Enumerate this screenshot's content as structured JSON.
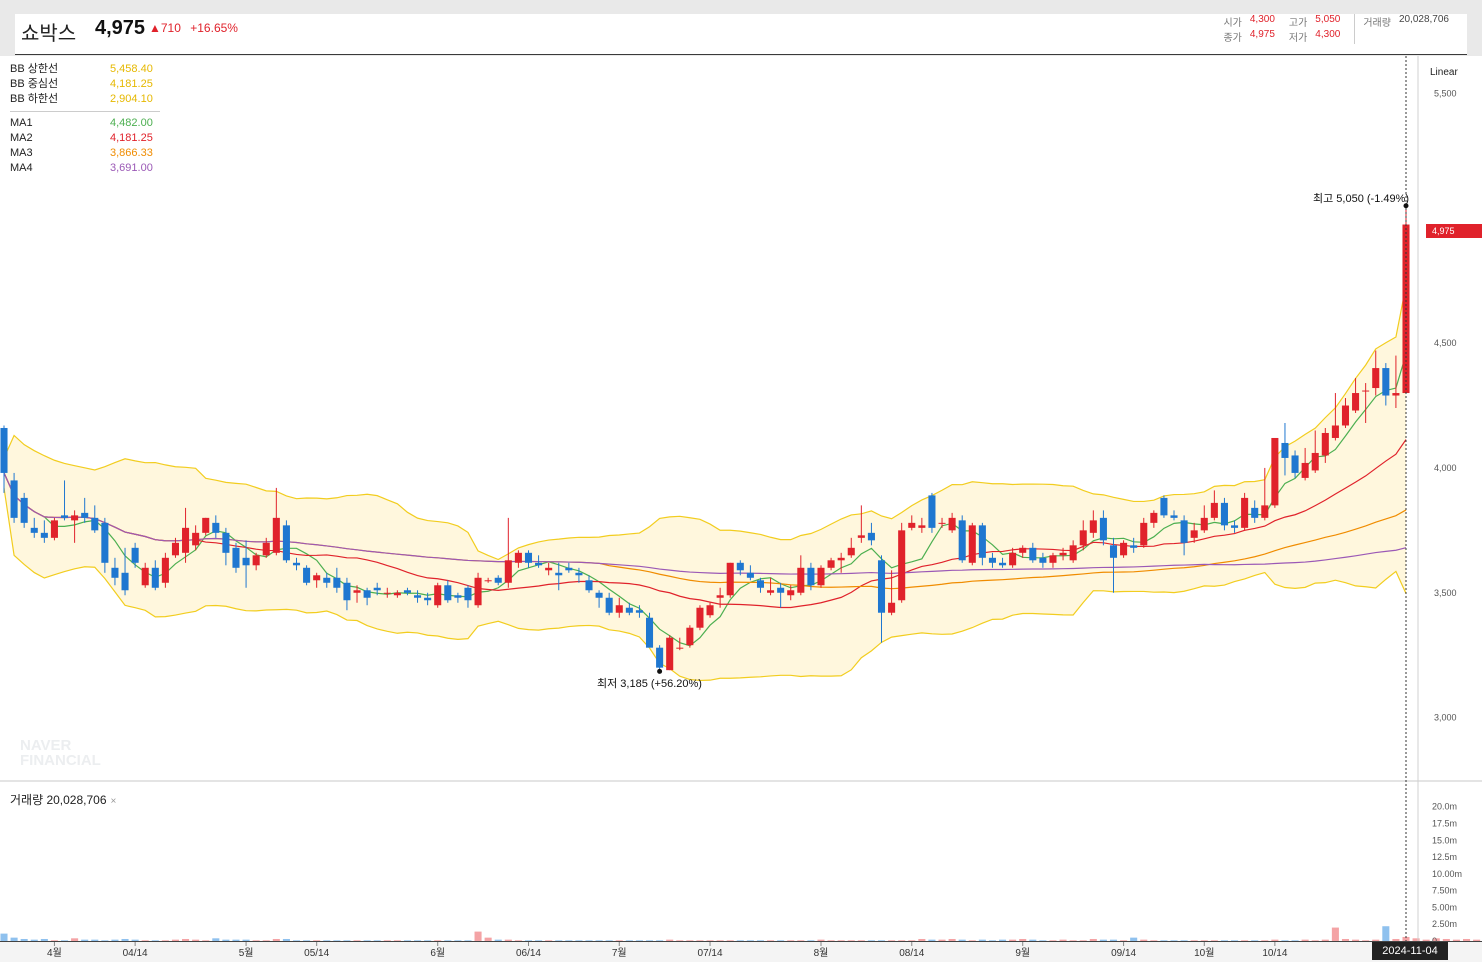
{
  "header": {
    "name": "쇼박스",
    "price": "4,975",
    "change": "▲710",
    "change_pct": "+16.65%",
    "ohlc": {
      "open_label": "시가",
      "open": "4,300",
      "high_label": "고가",
      "high": "5,050",
      "volume_label": "거래량",
      "volume": "20,028,706",
      "close_label": "종가",
      "close": "4,975",
      "low_label": "저가",
      "low": "4,300"
    }
  },
  "legend": {
    "bb": [
      {
        "name": "BB 상한선",
        "value": "5,458.40",
        "color": "#e6b800"
      },
      {
        "name": "BB 중심선",
        "value": "4,181.25",
        "color": "#e6b800"
      },
      {
        "name": "BB 하한선",
        "value": "2,904.10",
        "color": "#e6b800"
      }
    ],
    "ma": [
      {
        "name": "MA1",
        "value": "4,482.00",
        "color": "#4caf50"
      },
      {
        "name": "MA2",
        "value": "4,181.25",
        "color": "#e0222b"
      },
      {
        "name": "MA3",
        "value": "3,866.33",
        "color": "#f08c00"
      },
      {
        "name": "MA4",
        "value": "3,691.00",
        "color": "#9b59b6"
      }
    ]
  },
  "watermark": [
    "NAVER",
    "FINANCIAL"
  ],
  "scale_mode": "Linear",
  "volume_label": "거래량 20,028,706",
  "volume_close": "×",
  "current_price_badge": "4,975",
  "date_badge": "2024-11-04",
  "annotations": {
    "high": "최고 5,050 (-1.49%)",
    "low": "최저 3,185 (+56.20%)"
  },
  "colors": {
    "up": "#e0222b",
    "down": "#1f77d0",
    "band_fill": "#fff7dd",
    "band_line": "#f2cd1f"
  },
  "chart_data": {
    "type": "candlestick",
    "x_ticks": [
      "4월",
      "04/14",
      "5월",
      "05/14",
      "6월",
      "06/14",
      "7월",
      "07/14",
      "8월",
      "08/14",
      "9월",
      "09/14",
      "10월",
      "10/14"
    ],
    "y_ticks": [
      "5,500",
      "4,500",
      "4,000",
      "3,500",
      "3,000"
    ],
    "y_tick_values": [
      5500,
      4500,
      4000,
      3500,
      3000
    ],
    "ylim": [
      2750,
      5650
    ],
    "volume_ticks": [
      "20.0m",
      "17.5m",
      "15.0m",
      "12.5m",
      "10.00m",
      "7.50m",
      "5.00m",
      "2.50m",
      "0"
    ],
    "volume_tick_values": [
      20,
      17.5,
      15,
      12.5,
      10,
      7.5,
      5,
      2.5,
      0
    ],
    "volume_ylim": [
      0,
      21
    ],
    "candles": [
      [
        4160,
        4170,
        3900,
        3980
      ],
      [
        3950,
        3980,
        3780,
        3800
      ],
      [
        3880,
        3900,
        3760,
        3780
      ],
      [
        3760,
        3800,
        3720,
        3740
      ],
      [
        3740,
        3790,
        3700,
        3720
      ],
      [
        3720,
        3800,
        3710,
        3790
      ],
      [
        3810,
        3950,
        3790,
        3800
      ],
      [
        3790,
        3830,
        3700,
        3810
      ],
      [
        3820,
        3880,
        3780,
        3800
      ],
      [
        3800,
        3850,
        3740,
        3750
      ],
      [
        3780,
        3800,
        3580,
        3620
      ],
      [
        3600,
        3640,
        3530,
        3560
      ],
      [
        3580,
        3680,
        3490,
        3510
      ],
      [
        3680,
        3700,
        3600,
        3620
      ],
      [
        3530,
        3620,
        3520,
        3600
      ],
      [
        3600,
        3630,
        3510,
        3520
      ],
      [
        3540,
        3660,
        3520,
        3640
      ],
      [
        3650,
        3720,
        3640,
        3700
      ],
      [
        3660,
        3840,
        3620,
        3760
      ],
      [
        3690,
        3770,
        3670,
        3740
      ],
      [
        3740,
        3800,
        3730,
        3800
      ],
      [
        3780,
        3810,
        3720,
        3740
      ],
      [
        3740,
        3760,
        3610,
        3660
      ],
      [
        3680,
        3700,
        3580,
        3600
      ],
      [
        3640,
        3710,
        3520,
        3610
      ],
      [
        3610,
        3660,
        3590,
        3650
      ],
      [
        3650,
        3720,
        3640,
        3700
      ],
      [
        3660,
        3920,
        3650,
        3800
      ],
      [
        3770,
        3790,
        3620,
        3630
      ],
      [
        3620,
        3640,
        3590,
        3610
      ],
      [
        3600,
        3610,
        3530,
        3540
      ],
      [
        3550,
        3580,
        3520,
        3570
      ],
      [
        3560,
        3580,
        3520,
        3540
      ],
      [
        3560,
        3600,
        3500,
        3520
      ],
      [
        3540,
        3560,
        3430,
        3470
      ],
      [
        3500,
        3530,
        3460,
        3510
      ],
      [
        3510,
        3520,
        3450,
        3480
      ],
      [
        3520,
        3540,
        3490,
        3510
      ],
      [
        3500,
        3520,
        3480,
        3500
      ],
      [
        3490,
        3510,
        3480,
        3500
      ],
      [
        3510,
        3520,
        3490,
        3500
      ],
      [
        3490,
        3510,
        3460,
        3480
      ],
      [
        3480,
        3500,
        3450,
        3470
      ],
      [
        3450,
        3540,
        3440,
        3530
      ],
      [
        3530,
        3550,
        3460,
        3470
      ],
      [
        3490,
        3500,
        3460,
        3480
      ],
      [
        3520,
        3530,
        3440,
        3470
      ],
      [
        3450,
        3580,
        3440,
        3560
      ],
      [
        3550,
        3560,
        3540,
        3550
      ],
      [
        3560,
        3570,
        3530,
        3540
      ],
      [
        3540,
        3800,
        3520,
        3630
      ],
      [
        3620,
        3670,
        3600,
        3660
      ],
      [
        3660,
        3670,
        3600,
        3620
      ],
      [
        3620,
        3650,
        3600,
        3610
      ],
      [
        3590,
        3620,
        3570,
        3600
      ],
      [
        3580,
        3620,
        3510,
        3570
      ],
      [
        3600,
        3620,
        3580,
        3590
      ],
      [
        3580,
        3600,
        3540,
        3570
      ],
      [
        3550,
        3570,
        3500,
        3510
      ],
      [
        3500,
        3510,
        3440,
        3480
      ],
      [
        3480,
        3500,
        3410,
        3420
      ],
      [
        3420,
        3480,
        3400,
        3450
      ],
      [
        3440,
        3460,
        3410,
        3420
      ],
      [
        3430,
        3450,
        3400,
        3420
      ],
      [
        3400,
        3420,
        3300,
        3280
      ],
      [
        3280,
        3290,
        3185,
        3200
      ],
      [
        3190,
        3330,
        3190,
        3320
      ],
      [
        3280,
        3320,
        3270,
        3280
      ],
      [
        3290,
        3370,
        3280,
        3360
      ],
      [
        3360,
        3450,
        3350,
        3440
      ],
      [
        3410,
        3460,
        3400,
        3450
      ],
      [
        3480,
        3520,
        3440,
        3490
      ],
      [
        3490,
        3620,
        3480,
        3620
      ],
      [
        3620,
        3630,
        3570,
        3590
      ],
      [
        3580,
        3610,
        3550,
        3560
      ],
      [
        3550,
        3560,
        3500,
        3520
      ],
      [
        3500,
        3560,
        3490,
        3510
      ],
      [
        3520,
        3540,
        3440,
        3500
      ],
      [
        3490,
        3530,
        3470,
        3510
      ],
      [
        3500,
        3650,
        3490,
        3600
      ],
      [
        3600,
        3620,
        3510,
        3530
      ],
      [
        3530,
        3610,
        3520,
        3600
      ],
      [
        3600,
        3640,
        3590,
        3630
      ],
      [
        3630,
        3660,
        3580,
        3640
      ],
      [
        3650,
        3720,
        3640,
        3680
      ],
      [
        3720,
        3850,
        3700,
        3730
      ],
      [
        3740,
        3780,
        3690,
        3710
      ],
      [
        3630,
        3650,
        3300,
        3420
      ],
      [
        3420,
        3590,
        3410,
        3460
      ],
      [
        3470,
        3780,
        3460,
        3750
      ],
      [
        3760,
        3810,
        3750,
        3780
      ],
      [
        3760,
        3800,
        3740,
        3770
      ],
      [
        3890,
        3900,
        3740,
        3760
      ],
      [
        3780,
        3800,
        3760,
        3780
      ],
      [
        3750,
        3820,
        3740,
        3800
      ],
      [
        3790,
        3810,
        3620,
        3630
      ],
      [
        3620,
        3780,
        3610,
        3770
      ],
      [
        3770,
        3780,
        3610,
        3640
      ],
      [
        3640,
        3660,
        3600,
        3620
      ],
      [
        3620,
        3640,
        3600,
        3610
      ],
      [
        3610,
        3680,
        3600,
        3660
      ],
      [
        3660,
        3690,
        3640,
        3680
      ],
      [
        3680,
        3700,
        3620,
        3630
      ],
      [
        3640,
        3660,
        3600,
        3620
      ],
      [
        3620,
        3660,
        3600,
        3650
      ],
      [
        3650,
        3680,
        3630,
        3660
      ],
      [
        3630,
        3710,
        3620,
        3690
      ],
      [
        3690,
        3790,
        3670,
        3750
      ],
      [
        3740,
        3830,
        3720,
        3790
      ],
      [
        3800,
        3830,
        3690,
        3710
      ],
      [
        3690,
        3720,
        3500,
        3640
      ],
      [
        3650,
        3710,
        3640,
        3700
      ],
      [
        3690,
        3720,
        3660,
        3680
      ],
      [
        3690,
        3800,
        3680,
        3780
      ],
      [
        3780,
        3830,
        3760,
        3820
      ],
      [
        3880,
        3890,
        3800,
        3810
      ],
      [
        3810,
        3830,
        3790,
        3800
      ],
      [
        3790,
        3810,
        3650,
        3700
      ],
      [
        3720,
        3780,
        3700,
        3750
      ],
      [
        3750,
        3850,
        3740,
        3800
      ],
      [
        3800,
        3910,
        3790,
        3860
      ],
      [
        3860,
        3880,
        3750,
        3770
      ],
      [
        3770,
        3790,
        3740,
        3760
      ],
      [
        3760,
        3900,
        3750,
        3880
      ],
      [
        3840,
        3870,
        3780,
        3800
      ],
      [
        3800,
        4000,
        3790,
        3850
      ],
      [
        3850,
        4000,
        3840,
        4120
      ],
      [
        4100,
        4180,
        3970,
        4040
      ],
      [
        4050,
        4070,
        3960,
        3980
      ],
      [
        3960,
        4080,
        3950,
        4020
      ],
      [
        3990,
        4150,
        3980,
        4060
      ],
      [
        4050,
        4160,
        4020,
        4140
      ],
      [
        4120,
        4300,
        4110,
        4170
      ],
      [
        4170,
        4280,
        4160,
        4250
      ],
      [
        4230,
        4360,
        4220,
        4300
      ],
      [
        4310,
        4340,
        4180,
        4310
      ],
      [
        4320,
        4470,
        4290,
        4400
      ],
      [
        4400,
        4420,
        4250,
        4290
      ],
      [
        4290,
        4450,
        4240,
        4300
      ],
      [
        4300,
        5050,
        4300,
        4975
      ]
    ],
    "volumes_m": [
      1.1,
      0.5,
      0.3,
      0.2,
      0.3,
      0.1,
      0.1,
      0.4,
      0.2,
      0.2,
      0.1,
      0.2,
      0.3,
      0.2,
      0.1,
      0.1,
      0.1,
      0.2,
      0.3,
      0.2,
      0.1,
      0.4,
      0.2,
      0.2,
      0.2,
      0.1,
      0.1,
      0.3,
      0.3,
      0.1,
      0.1,
      0.1,
      0.1,
      0.1,
      0.1,
      0.1,
      0.1,
      0.1,
      0.1,
      0.1,
      0.1,
      0.1,
      0.1,
      0.1,
      0.1,
      0.1,
      0.1,
      1.4,
      0.5,
      0.2,
      0.2,
      0.1,
      0.1,
      0.1,
      0.1,
      0.1,
      0.1,
      0.1,
      0.1,
      0.1,
      0.1,
      0.1,
      0.1,
      0.1,
      0.1,
      0.1,
      0.2,
      0.1,
      0.1,
      0.1,
      0.1,
      0.1,
      0.1,
      0.1,
      0.1,
      0.1,
      0.1,
      0.1,
      0.1,
      0.1,
      0.1,
      0.2,
      0.1,
      0.1,
      0.1,
      0.1,
      0.1,
      0.1,
      0.1,
      0.1,
      0.1,
      0.3,
      0.2,
      0.2,
      0.3,
      0.2,
      0.1,
      0.2,
      0.1,
      0.2,
      0.2,
      0.3,
      0.2,
      0.1,
      0.1,
      0.2,
      0.1,
      0.1,
      0.3,
      0.2,
      0.2,
      0.1,
      0.5,
      0.2,
      0.1,
      0.1,
      0.1,
      0.1,
      0.1,
      0.1,
      0.1,
      0.1,
      0.1,
      0.1,
      0.1,
      0.1,
      0.2,
      0.1,
      0.1,
      0.2,
      0.1,
      0.2,
      2.0,
      0.3,
      0.2,
      0.1,
      0.2,
      2.2,
      0.3,
      0.6,
      0.4,
      0.2,
      0.4,
      0.3,
      0.2,
      0.3,
      0.2,
      20.0
    ]
  }
}
